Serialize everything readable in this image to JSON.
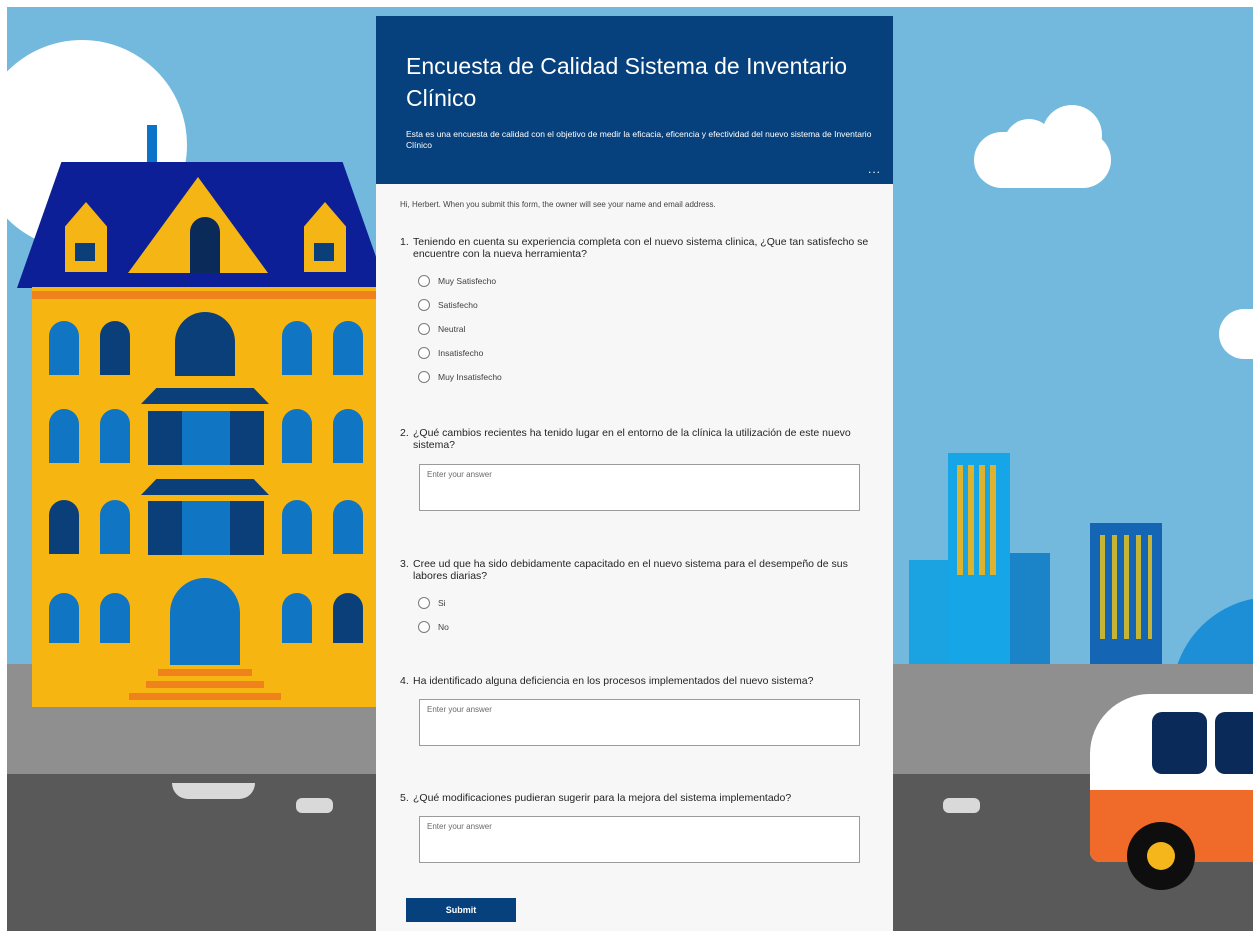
{
  "form": {
    "title": "Encuesta de Calidad Sistema de Inventario Clínico",
    "description": "Esta es una encuesta de calidad con el objetivo de medir la eficacia, eficencia y efectividad del nuevo sistema de Inventario Clínico",
    "more_icon": "ellipsis-icon",
    "more_label": "...",
    "owner_note": "Hi, Herbert. When you submit this form, the owner will see your name and email address.",
    "submit_label": "Submit",
    "colors": {
      "banner": "#06417d",
      "submit": "#06417d",
      "background": "#72b9dd"
    }
  },
  "questions": [
    {
      "number": "1.",
      "text": "Teniendo en cuenta su experiencia completa con el nuevo sistema clinica, ¿Que tan satisfecho se encuentre con la nueva herramienta?",
      "type": "choice",
      "options": [
        "Muy Satisfecho",
        "Satisfecho",
        "Neutral",
        "Insatisfecho",
        "Muy Insatisfecho"
      ]
    },
    {
      "number": "2.",
      "text": "¿Qué cambios recientes ha tenido lugar en el entorno de la clínica la utilización de este nuevo sistema?",
      "type": "text",
      "placeholder": "Enter your answer"
    },
    {
      "number": "3.",
      "text": "Cree ud que ha sido debidamente capacitado en el nuevo sistema para el desempeño de sus labores diarias?",
      "type": "choice",
      "options": [
        "Si",
        "No"
      ]
    },
    {
      "number": "4.",
      "text": "Ha identificado alguna deficiencia en los procesos implementados del nuevo sistema?",
      "type": "text",
      "placeholder": "Enter your answer"
    },
    {
      "number": "5.",
      "text": "¿Qué modificaciones pudieran sugerir para la mejora del sistema implementado?",
      "type": "text",
      "placeholder": "Enter your answer"
    }
  ],
  "background_theme": "city-illustration"
}
